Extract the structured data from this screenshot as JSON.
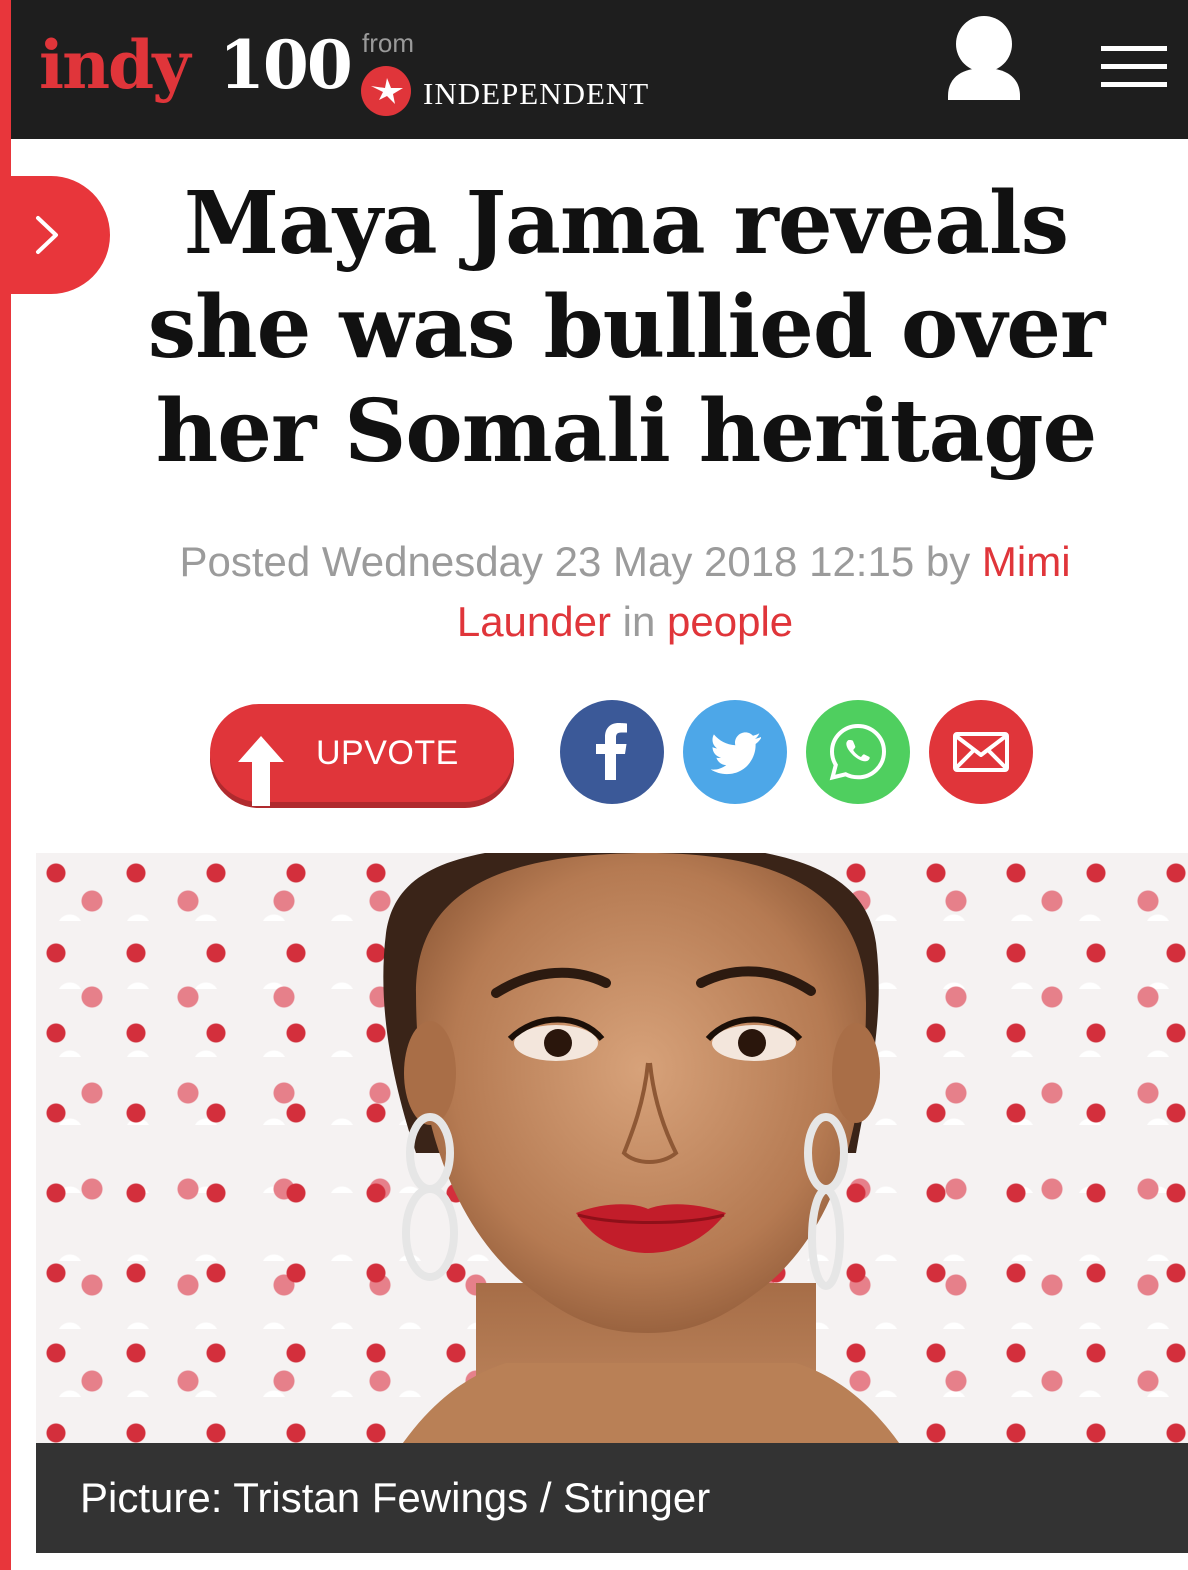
{
  "header": {
    "logo_indy": "indy",
    "logo_100": "100",
    "logo_from": "from",
    "logo_publisher": "INDEPENDENT",
    "user_icon": "user-icon",
    "menu_icon": "hamburger-menu-icon"
  },
  "side_tab_icon": "chevron-right-icon",
  "article": {
    "headline": "Maya Jama reveals she was bullied over her Somali heritage",
    "byline": {
      "posted_prefix": "Posted Wednesday 23 May 2018 12:15 by ",
      "author": "Mimi Launder",
      "in_word": " in ",
      "section": "people"
    }
  },
  "actions": {
    "upvote_label": "UPVOTE",
    "share": [
      {
        "name": "facebook",
        "icon": "facebook-icon",
        "color": "#3b5998"
      },
      {
        "name": "twitter",
        "icon": "twitter-icon",
        "color": "#4da7e8"
      },
      {
        "name": "whatsapp",
        "icon": "whatsapp-icon",
        "color": "#4fcf5f"
      },
      {
        "name": "email",
        "icon": "email-icon",
        "color": "#e0353a"
      }
    ]
  },
  "image": {
    "caption": "Picture: Tristan Fewings / Stringer"
  },
  "colors": {
    "brand_red": "#e0353a",
    "header_bg": "#1e1e1e",
    "caption_bg": "#333333",
    "byline_grey": "#9b9b9b"
  }
}
